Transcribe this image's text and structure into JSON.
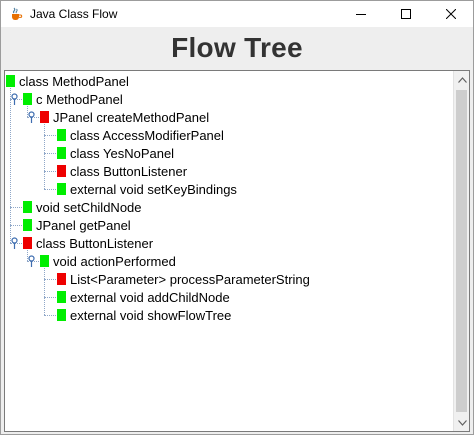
{
  "window": {
    "title": "Java Class Flow",
    "app_icon": "java-cup-icon",
    "controls": [
      "minimize-icon",
      "maximize-icon",
      "close-icon"
    ]
  },
  "header": {
    "title": "Flow Tree"
  },
  "tree": {
    "colors": {
      "green": "#00ee00",
      "red": "#ee0000"
    },
    "nodes": [
      {
        "label": "class MethodPanel",
        "status": "green",
        "depth": 0
      },
      {
        "label": "c MethodPanel",
        "status": "green",
        "depth": 1,
        "expanded": true
      },
      {
        "label": "JPanel createMethodPanel",
        "status": "red",
        "depth": 2,
        "expanded": true
      },
      {
        "label": "class AccessModifierPanel",
        "status": "green",
        "depth": 3
      },
      {
        "label": "class YesNoPanel",
        "status": "green",
        "depth": 3
      },
      {
        "label": "class ButtonListener",
        "status": "red",
        "depth": 3
      },
      {
        "label": "external void setKeyBindings",
        "status": "green",
        "depth": 3
      },
      {
        "label": "void setChildNode",
        "status": "green",
        "depth": 1
      },
      {
        "label": "JPanel getPanel",
        "status": "green",
        "depth": 1
      },
      {
        "label": "class ButtonListener",
        "status": "red",
        "depth": 1,
        "expanded": true
      },
      {
        "label": "void actionPerformed",
        "status": "green",
        "depth": 2,
        "expanded": true
      },
      {
        "label": "List<Parameter> processParameterString",
        "status": "red",
        "depth": 3
      },
      {
        "label": "external void addChildNode",
        "status": "green",
        "depth": 3
      },
      {
        "label": "external void showFlowTree",
        "status": "green",
        "depth": 3
      }
    ]
  },
  "scrollbar": {
    "up_icon": "scroll-up-arrow-icon",
    "down_icon": "scroll-down-arrow-icon"
  }
}
